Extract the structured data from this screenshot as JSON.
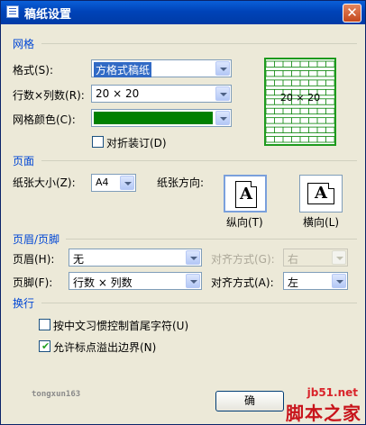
{
  "window": {
    "title": "稿纸设置",
    "close": "✕"
  },
  "grid": {
    "section": "网格",
    "format_label": "格式(S):",
    "format_value": "方格式稿纸",
    "rowcol_label": "行数×列数(R):",
    "rowcol_value": "20 × 20",
    "color_label": "网格颜色(C):",
    "color_value": "#008000",
    "fold_label": "对折装订(D)",
    "preview_text": "20 × 20"
  },
  "page": {
    "section": "页面",
    "size_label": "纸张大小(Z):",
    "size_value": "A4",
    "orient_label": "纸张方向:",
    "portrait_label": "纵向(T)",
    "landscape_label": "横向(L)",
    "page_glyph": "A"
  },
  "headerfooter": {
    "section": "页眉/页脚",
    "header_label": "页眉(H):",
    "header_value": "无",
    "header_align_label": "对齐方式(G):",
    "header_align_value": "右",
    "footer_label": "页脚(F):",
    "footer_value": "行数 × 列数",
    "footer_align_label": "对齐方式(A):",
    "footer_align_value": "左"
  },
  "wrap": {
    "section": "换行",
    "option1": "按中文习惯控制首尾字符(U)",
    "option1_checked": false,
    "option2": "允许标点溢出边界(N)",
    "option2_checked": true
  },
  "footer_area": {
    "watermark": "tongxun163",
    "ok_label": "确"
  },
  "site": {
    "url": "jb51.net",
    "name": "脚本之家"
  },
  "checkmark": "✔"
}
